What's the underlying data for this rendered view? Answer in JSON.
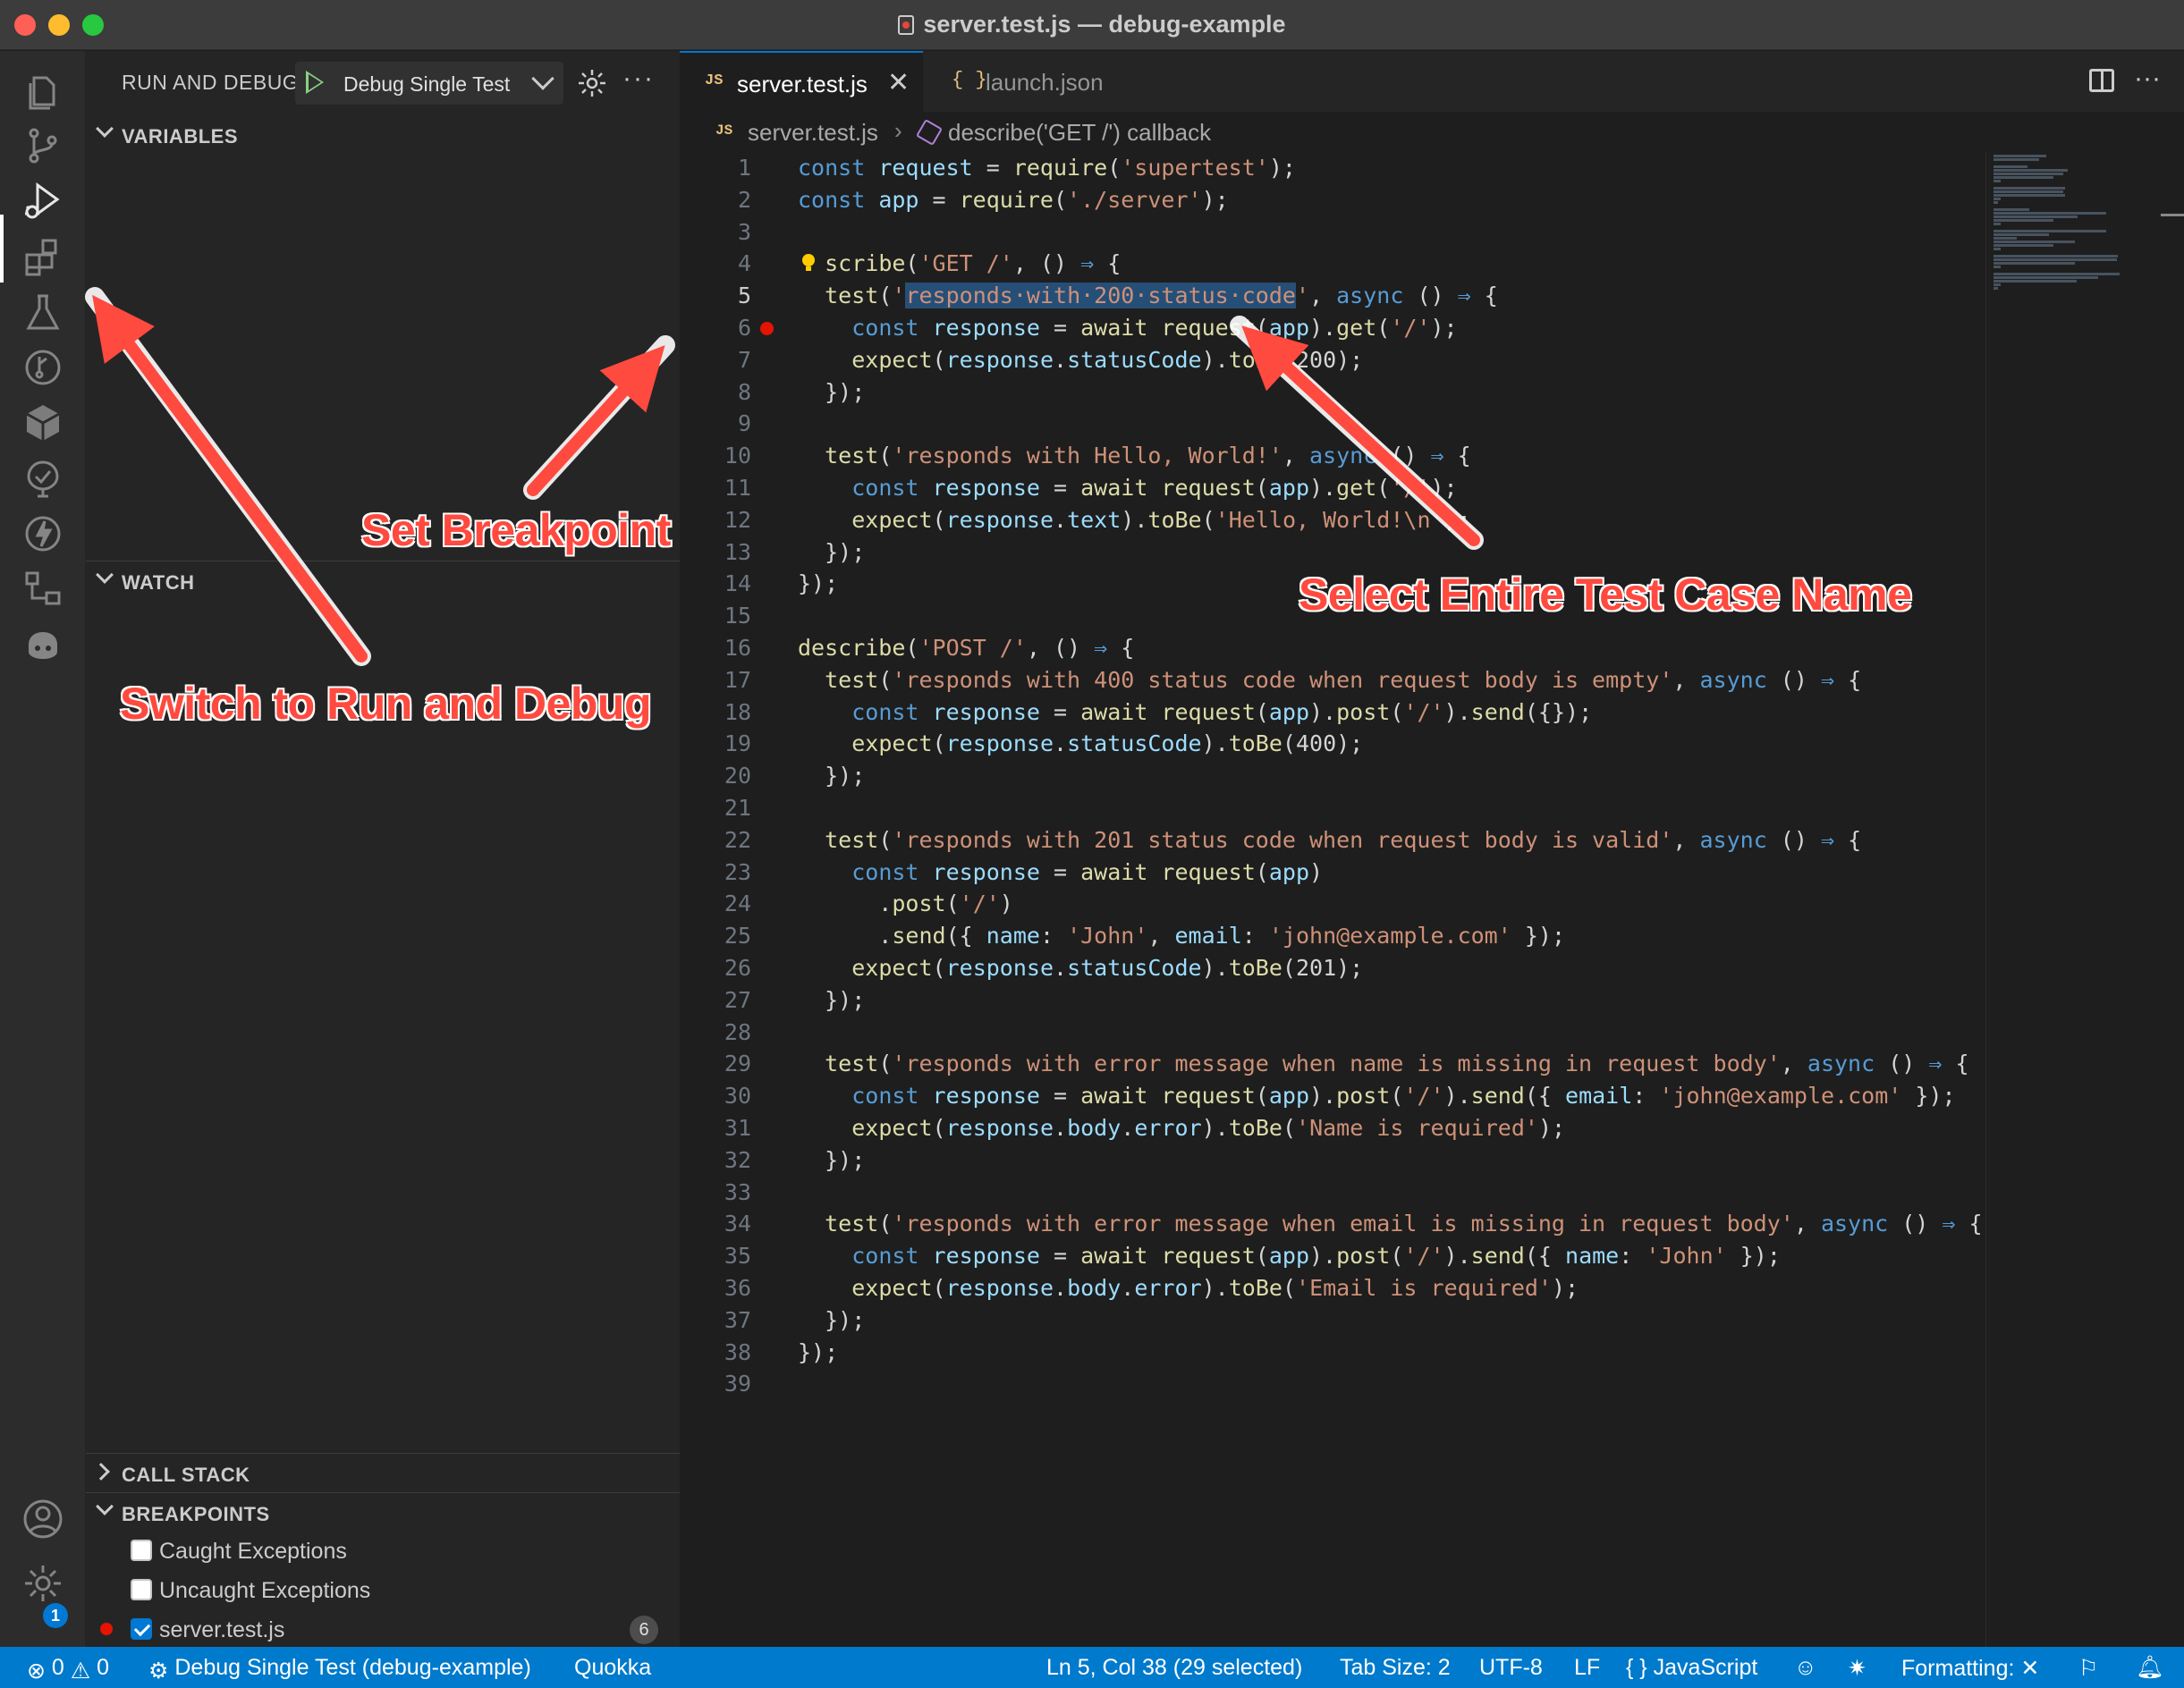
{
  "window": {
    "title": "server.test.js — debug-example"
  },
  "activity_bar": {
    "items": [
      "files-icon",
      "source-control-icon",
      "run-debug-icon",
      "extensions-icon",
      "testing-icon",
      "git-graph-icon",
      "package-icon",
      "remote-icon",
      "lightning-icon",
      "diagram-icon",
      "copilot-icon"
    ],
    "bottom": [
      "account-icon",
      "manage-gear-icon"
    ],
    "manage_badge": "1"
  },
  "sidebar": {
    "title": "RUN AND DEBUG",
    "config_name": "Debug Single Test",
    "sections": {
      "variables": "VARIABLES",
      "watch": "WATCH",
      "call_stack": "CALL STACK",
      "breakpoints": "BREAKPOINTS"
    },
    "breakpoints": [
      {
        "label": "Caught Exceptions",
        "checked": false
      },
      {
        "label": "Uncaught Exceptions",
        "checked": false
      },
      {
        "label": "server.test.js",
        "checked": true,
        "count": "6"
      }
    ]
  },
  "editor": {
    "tabs": [
      {
        "label": "server.test.js",
        "icon": "JS",
        "active": true
      },
      {
        "label": "launch.json",
        "icon": "{ }",
        "active": false
      }
    ],
    "breadcrumb": {
      "file_icon": "JS",
      "file": "server.test.js",
      "symbol": "describe('GET /') callback"
    },
    "current_line": 5,
    "breakpoint_line": 6,
    "line_numbers": [
      "1",
      "2",
      "3",
      "4",
      "5",
      "6",
      "7",
      "8",
      "9",
      "10",
      "11",
      "12",
      "13",
      "14",
      "15",
      "16",
      "17",
      "18",
      "19",
      "20",
      "21",
      "22",
      "23",
      "24",
      "25",
      "26",
      "27",
      "28",
      "29",
      "30",
      "31",
      "32",
      "33",
      "34",
      "35",
      "36",
      "37",
      "38",
      "39"
    ]
  },
  "status_bar": {
    "errors": "0",
    "warnings": "0",
    "debug_config": "Debug Single Test (debug-example)",
    "quokka": "Quokka",
    "cursor": "Ln 5, Col 38 (29 selected)",
    "tab_size": "Tab Size: 2",
    "encoding": "UTF-8",
    "eol": "LF",
    "language": "JavaScript",
    "formatting": "Formatting:",
    "accent_color": "#007acc"
  },
  "annotations": {
    "set_breakpoint": "Set Breakpoint",
    "select_name": "Select Entire Test Case Name",
    "switch_debug": "Switch to Run and Debug",
    "color": "#ff4a3f"
  }
}
